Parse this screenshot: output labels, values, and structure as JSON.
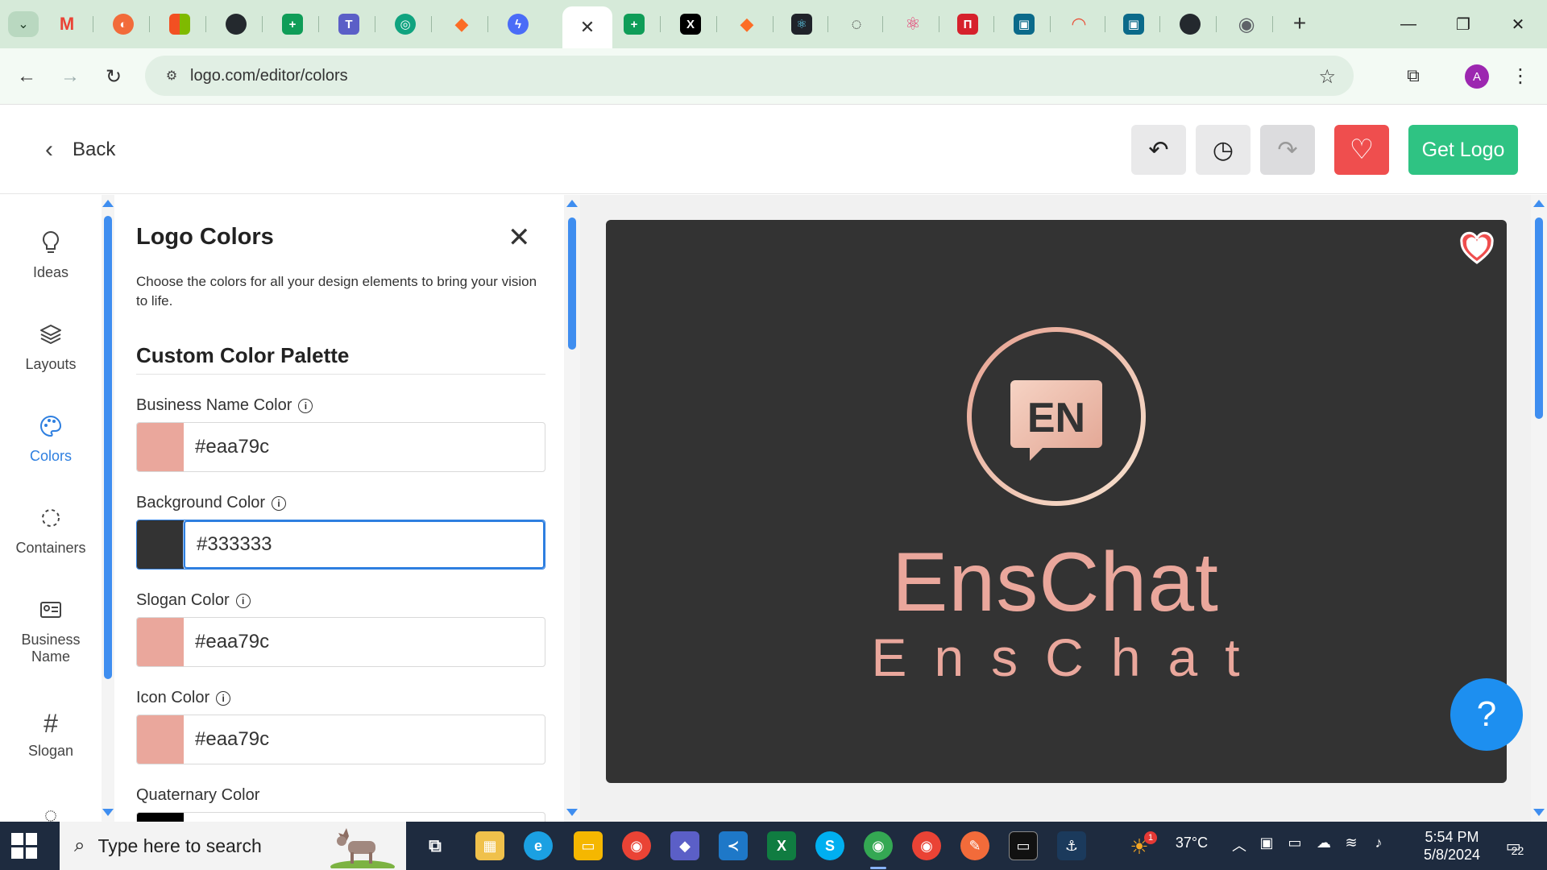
{
  "browser": {
    "tabs": [
      {
        "name": "gmail",
        "glyph": "M",
        "color": "#ea4335"
      },
      {
        "name": "figma-like",
        "glyph": "◐",
        "color": "#f26b3a"
      },
      {
        "name": "microsoft",
        "glyph": "▦",
        "color": "#f25022"
      },
      {
        "name": "github",
        "glyph": "●",
        "color": "#24292e"
      },
      {
        "name": "sheets",
        "glyph": "+",
        "color": "#0f9d58"
      },
      {
        "name": "teams",
        "glyph": "T",
        "color": "#5b5fc7"
      },
      {
        "name": "chatgpt",
        "glyph": "◎",
        "color": "#10a37f"
      },
      {
        "name": "gitlab",
        "glyph": "◆",
        "color": "#fc6d26"
      },
      {
        "name": "bolt",
        "glyph": "ϟ",
        "color": "#4a6cf7"
      },
      {
        "name": "active",
        "glyph": "✕",
        "color": "#ffffff"
      },
      {
        "name": "sheets-2",
        "glyph": "+",
        "color": "#0f9d58"
      },
      {
        "name": "x",
        "glyph": "X",
        "color": "#000000"
      },
      {
        "name": "gitlab-2",
        "glyph": "◆",
        "color": "#fc6d26"
      },
      {
        "name": "react",
        "glyph": "⚛",
        "color": "#20232a"
      },
      {
        "name": "search-chat",
        "glyph": "◌",
        "color": "#333333"
      },
      {
        "name": "react-2",
        "glyph": "⚛",
        "color": "#e8336d"
      },
      {
        "name": "netlify",
        "glyph": "П",
        "color": "#d6212c"
      },
      {
        "name": "vs",
        "glyph": "▣",
        "color": "#0b6a8a"
      },
      {
        "name": "rainbow",
        "glyph": "◠",
        "color": "#3a7bd5"
      },
      {
        "name": "vs-2",
        "glyph": "▣",
        "color": "#0b6a8a"
      },
      {
        "name": "github-2",
        "glyph": "●",
        "color": "#24292e"
      },
      {
        "name": "chrome",
        "glyph": "◉",
        "color": "#5f6368"
      }
    ],
    "new_tab": "+",
    "url": "logo.com/editor/colors",
    "profile_initial": "A"
  },
  "header": {
    "back_label": "Back",
    "undo_icon": "↶",
    "history_icon": "◷",
    "redo_icon": "↷",
    "favorite_icon": "♡",
    "get_logo_label": "Get Logo"
  },
  "rail": {
    "items": [
      {
        "label": "Ideas",
        "icon": "lightbulb-icon",
        "glyph": "💡"
      },
      {
        "label": "Layouts",
        "icon": "layers-icon",
        "glyph": "◈"
      },
      {
        "label": "Colors",
        "icon": "palette-icon",
        "glyph": "🎨"
      },
      {
        "label": "Containers",
        "icon": "container-icon",
        "glyph": "⬚"
      },
      {
        "label": "Business Name",
        "icon": "id-card-icon",
        "glyph": "▤"
      },
      {
        "label": "Slogan",
        "icon": "hash-icon",
        "glyph": "#"
      }
    ],
    "active": "Colors"
  },
  "panel": {
    "title": "Logo Colors",
    "description": "Choose the colors for all your design elements to bring your vision to life.",
    "section_title": "Custom Color Palette",
    "fields": [
      {
        "label": "Business Name Color",
        "value": "#eaa79c",
        "swatch": "#eaa79c",
        "info": true
      },
      {
        "label": "Background Color",
        "value": "#333333",
        "swatch": "#333333",
        "info": true
      },
      {
        "label": "Slogan Color",
        "value": "#eaa79c",
        "swatch": "#eaa79c",
        "info": true
      },
      {
        "label": "Icon Color",
        "value": "#eaa79c",
        "swatch": "#eaa79c",
        "info": true
      },
      {
        "label": "Quaternary Color",
        "value": "",
        "swatch": "#000000",
        "info": false
      }
    ]
  },
  "canvas": {
    "background": "#333333",
    "emblem_text": "EN",
    "business_name": "EnsChat",
    "slogan": "EnsChat",
    "accent": "#eaa79c"
  },
  "help_label": "?",
  "taskbar": {
    "search_placeholder": "Type here to search",
    "weather": "37°C",
    "weather_badge": "1",
    "time": "5:54 PM",
    "date": "5/8/2024",
    "notification_count": "22"
  }
}
